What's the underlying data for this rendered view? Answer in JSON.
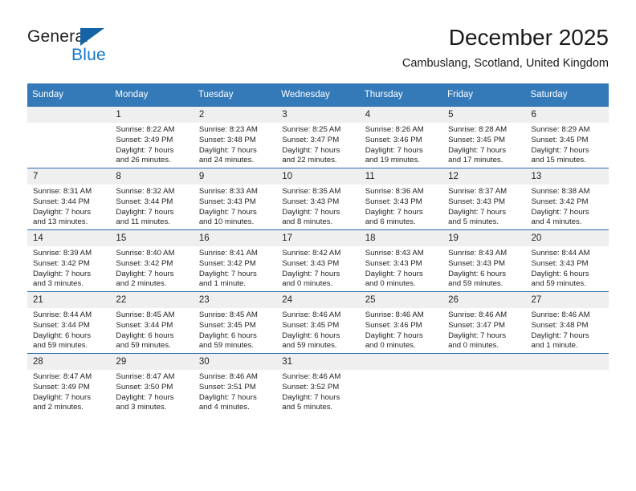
{
  "logo": {
    "name_part1": "General",
    "name_part2": "Blue",
    "triangle_color": "#1464a5",
    "blue_color": "#1477c9"
  },
  "header": {
    "title": "December 2025",
    "subtitle": "Cambuslang, Scotland, United Kingdom"
  },
  "theme": {
    "header_bg": "#3479b8",
    "row_divider": "#2a6ca8",
    "daynum_bg": "#efeff0"
  },
  "weekdays": [
    "Sunday",
    "Monday",
    "Tuesday",
    "Wednesday",
    "Thursday",
    "Friday",
    "Saturday"
  ],
  "weeks": [
    [
      {
        "day": "",
        "empty": true
      },
      {
        "day": "1",
        "sunrise": "Sunrise: 8:22 AM",
        "sunset": "Sunset: 3:49 PM",
        "daylight1": "Daylight: 7 hours",
        "daylight2": "and 26 minutes."
      },
      {
        "day": "2",
        "sunrise": "Sunrise: 8:23 AM",
        "sunset": "Sunset: 3:48 PM",
        "daylight1": "Daylight: 7 hours",
        "daylight2": "and 24 minutes."
      },
      {
        "day": "3",
        "sunrise": "Sunrise: 8:25 AM",
        "sunset": "Sunset: 3:47 PM",
        "daylight1": "Daylight: 7 hours",
        "daylight2": "and 22 minutes."
      },
      {
        "day": "4",
        "sunrise": "Sunrise: 8:26 AM",
        "sunset": "Sunset: 3:46 PM",
        "daylight1": "Daylight: 7 hours",
        "daylight2": "and 19 minutes."
      },
      {
        "day": "5",
        "sunrise": "Sunrise: 8:28 AM",
        "sunset": "Sunset: 3:45 PM",
        "daylight1": "Daylight: 7 hours",
        "daylight2": "and 17 minutes."
      },
      {
        "day": "6",
        "sunrise": "Sunrise: 8:29 AM",
        "sunset": "Sunset: 3:45 PM",
        "daylight1": "Daylight: 7 hours",
        "daylight2": "and 15 minutes."
      }
    ],
    [
      {
        "day": "7",
        "sunrise": "Sunrise: 8:31 AM",
        "sunset": "Sunset: 3:44 PM",
        "daylight1": "Daylight: 7 hours",
        "daylight2": "and 13 minutes."
      },
      {
        "day": "8",
        "sunrise": "Sunrise: 8:32 AM",
        "sunset": "Sunset: 3:44 PM",
        "daylight1": "Daylight: 7 hours",
        "daylight2": "and 11 minutes."
      },
      {
        "day": "9",
        "sunrise": "Sunrise: 8:33 AM",
        "sunset": "Sunset: 3:43 PM",
        "daylight1": "Daylight: 7 hours",
        "daylight2": "and 10 minutes."
      },
      {
        "day": "10",
        "sunrise": "Sunrise: 8:35 AM",
        "sunset": "Sunset: 3:43 PM",
        "daylight1": "Daylight: 7 hours",
        "daylight2": "and 8 minutes."
      },
      {
        "day": "11",
        "sunrise": "Sunrise: 8:36 AM",
        "sunset": "Sunset: 3:43 PM",
        "daylight1": "Daylight: 7 hours",
        "daylight2": "and 6 minutes."
      },
      {
        "day": "12",
        "sunrise": "Sunrise: 8:37 AM",
        "sunset": "Sunset: 3:43 PM",
        "daylight1": "Daylight: 7 hours",
        "daylight2": "and 5 minutes."
      },
      {
        "day": "13",
        "sunrise": "Sunrise: 8:38 AM",
        "sunset": "Sunset: 3:42 PM",
        "daylight1": "Daylight: 7 hours",
        "daylight2": "and 4 minutes."
      }
    ],
    [
      {
        "day": "14",
        "sunrise": "Sunrise: 8:39 AM",
        "sunset": "Sunset: 3:42 PM",
        "daylight1": "Daylight: 7 hours",
        "daylight2": "and 3 minutes."
      },
      {
        "day": "15",
        "sunrise": "Sunrise: 8:40 AM",
        "sunset": "Sunset: 3:42 PM",
        "daylight1": "Daylight: 7 hours",
        "daylight2": "and 2 minutes."
      },
      {
        "day": "16",
        "sunrise": "Sunrise: 8:41 AM",
        "sunset": "Sunset: 3:42 PM",
        "daylight1": "Daylight: 7 hours",
        "daylight2": "and 1 minute."
      },
      {
        "day": "17",
        "sunrise": "Sunrise: 8:42 AM",
        "sunset": "Sunset: 3:43 PM",
        "daylight1": "Daylight: 7 hours",
        "daylight2": "and 0 minutes."
      },
      {
        "day": "18",
        "sunrise": "Sunrise: 8:43 AM",
        "sunset": "Sunset: 3:43 PM",
        "daylight1": "Daylight: 7 hours",
        "daylight2": "and 0 minutes."
      },
      {
        "day": "19",
        "sunrise": "Sunrise: 8:43 AM",
        "sunset": "Sunset: 3:43 PM",
        "daylight1": "Daylight: 6 hours",
        "daylight2": "and 59 minutes."
      },
      {
        "day": "20",
        "sunrise": "Sunrise: 8:44 AM",
        "sunset": "Sunset: 3:43 PM",
        "daylight1": "Daylight: 6 hours",
        "daylight2": "and 59 minutes."
      }
    ],
    [
      {
        "day": "21",
        "sunrise": "Sunrise: 8:44 AM",
        "sunset": "Sunset: 3:44 PM",
        "daylight1": "Daylight: 6 hours",
        "daylight2": "and 59 minutes."
      },
      {
        "day": "22",
        "sunrise": "Sunrise: 8:45 AM",
        "sunset": "Sunset: 3:44 PM",
        "daylight1": "Daylight: 6 hours",
        "daylight2": "and 59 minutes."
      },
      {
        "day": "23",
        "sunrise": "Sunrise: 8:45 AM",
        "sunset": "Sunset: 3:45 PM",
        "daylight1": "Daylight: 6 hours",
        "daylight2": "and 59 minutes."
      },
      {
        "day": "24",
        "sunrise": "Sunrise: 8:46 AM",
        "sunset": "Sunset: 3:45 PM",
        "daylight1": "Daylight: 6 hours",
        "daylight2": "and 59 minutes."
      },
      {
        "day": "25",
        "sunrise": "Sunrise: 8:46 AM",
        "sunset": "Sunset: 3:46 PM",
        "daylight1": "Daylight: 7 hours",
        "daylight2": "and 0 minutes."
      },
      {
        "day": "26",
        "sunrise": "Sunrise: 8:46 AM",
        "sunset": "Sunset: 3:47 PM",
        "daylight1": "Daylight: 7 hours",
        "daylight2": "and 0 minutes."
      },
      {
        "day": "27",
        "sunrise": "Sunrise: 8:46 AM",
        "sunset": "Sunset: 3:48 PM",
        "daylight1": "Daylight: 7 hours",
        "daylight2": "and 1 minute."
      }
    ],
    [
      {
        "day": "28",
        "sunrise": "Sunrise: 8:47 AM",
        "sunset": "Sunset: 3:49 PM",
        "daylight1": "Daylight: 7 hours",
        "daylight2": "and 2 minutes."
      },
      {
        "day": "29",
        "sunrise": "Sunrise: 8:47 AM",
        "sunset": "Sunset: 3:50 PM",
        "daylight1": "Daylight: 7 hours",
        "daylight2": "and 3 minutes."
      },
      {
        "day": "30",
        "sunrise": "Sunrise: 8:46 AM",
        "sunset": "Sunset: 3:51 PM",
        "daylight1": "Daylight: 7 hours",
        "daylight2": "and 4 minutes."
      },
      {
        "day": "31",
        "sunrise": "Sunrise: 8:46 AM",
        "sunset": "Sunset: 3:52 PM",
        "daylight1": "Daylight: 7 hours",
        "daylight2": "and 5 minutes."
      },
      {
        "day": "",
        "empty": true
      },
      {
        "day": "",
        "empty": true
      },
      {
        "day": "",
        "empty": true
      }
    ]
  ]
}
